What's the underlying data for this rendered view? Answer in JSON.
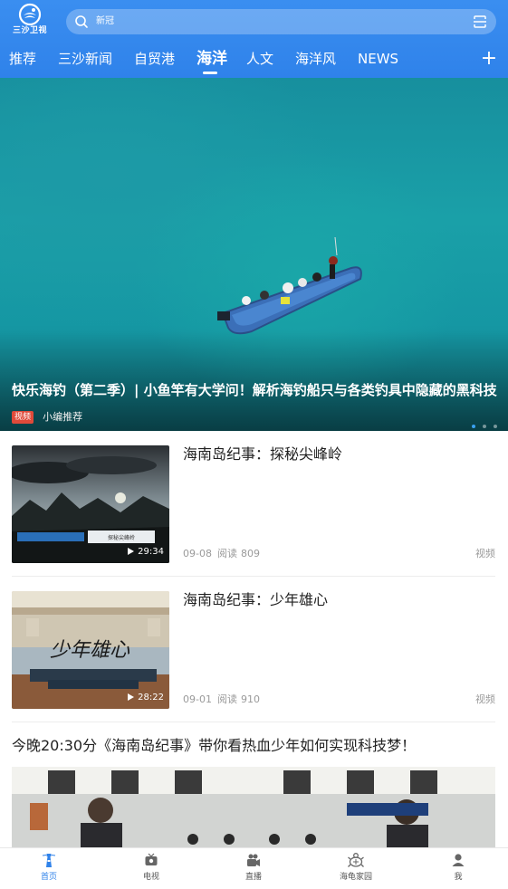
{
  "header": {
    "logo_text": "三沙卫视",
    "search_placeholder": "新冠"
  },
  "tabs": [
    {
      "label": "推荐"
    },
    {
      "label": "三沙新闻"
    },
    {
      "label": "自贸港"
    },
    {
      "label": "海洋"
    },
    {
      "label": "人文"
    },
    {
      "label": "海洋风"
    },
    {
      "label": "NEWS"
    }
  ],
  "active_tab": "海洋",
  "banner": {
    "title": "快乐海钓（第二季）| 小鱼竿有大学问！解析海钓船只与各类钓具中隐藏的黑科技",
    "badge": "视频",
    "source": "小编推荐"
  },
  "items": [
    {
      "title": "海南岛纪事：探秘尖峰岭",
      "duration": "29:34",
      "date": "09-08",
      "views_label": "阅读",
      "views": "809",
      "type": "视频",
      "thumb_caption": "探秘尖峰岭"
    },
    {
      "title": "海南岛纪事：少年雄心",
      "duration": "28:22",
      "date": "09-01",
      "views_label": "阅读",
      "views": "910",
      "type": "视频",
      "thumb_caption": "少年雄心"
    }
  ],
  "article": {
    "title": "今晚20:30分《海南岛纪事》带你看热血少年如何实现科技梦！"
  },
  "bottom_nav": [
    {
      "label": "首页",
      "icon": "lighthouse-icon"
    },
    {
      "label": "电视",
      "icon": "tv-icon"
    },
    {
      "label": "直播",
      "icon": "camera-icon"
    },
    {
      "label": "海龟家园",
      "icon": "turtle-icon"
    },
    {
      "label": "我",
      "icon": "user-icon"
    }
  ],
  "colors": {
    "brand": "#2f82ea",
    "badge": "#e04a3a"
  }
}
